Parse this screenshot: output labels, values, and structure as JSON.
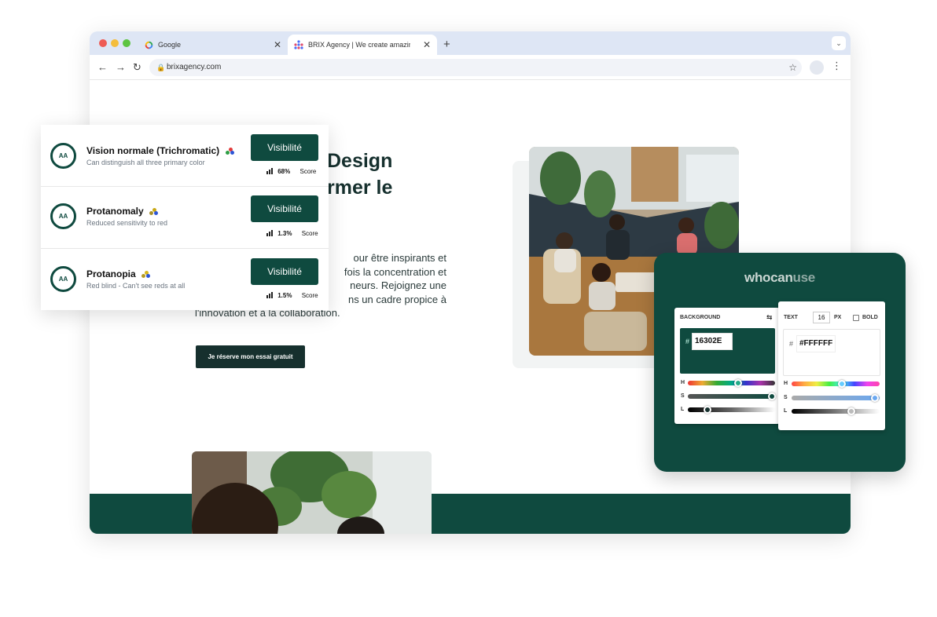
{
  "browser": {
    "tabs": [
      {
        "label": "Google",
        "close": "✕"
      },
      {
        "label": "BRIX Agency | We create amazing w",
        "close": "✕"
      }
    ],
    "new_tab": "+",
    "tab_menu": "⌄",
    "nav": {
      "back": "←",
      "forward": "→",
      "reload": "↻"
    },
    "address": "brixagency.com",
    "star": "☆",
    "menu": "⋮"
  },
  "page": {
    "hero_title_line1": "Design",
    "hero_title_line2": "rmer le",
    "hero_text_lines": [
      "our être inspirants et",
      "fois la concentration et",
      "neurs. Rejoignez une",
      "ns un cadre propice à",
      "l'innovation et à la collaboration."
    ],
    "cta_label": "Je réserve mon essai gratuit"
  },
  "vision": {
    "items": [
      {
        "badge": "AA",
        "name": "Vision normale (Trichromatic)",
        "description": "Can distinguish all three primary color",
        "button": "Visibilité",
        "percent": "68%",
        "score_label": "Score"
      },
      {
        "badge": "AA",
        "name": "Protanomaly",
        "description": "Reduced sensitivity to red",
        "button": "Visibilité",
        "percent": "1.3%",
        "score_label": "Score"
      },
      {
        "badge": "AA",
        "name": "Protanopia",
        "description": "Red blind - Can't see reds at all",
        "button": "Visibilité",
        "percent": "1.5%",
        "score_label": "Score"
      }
    ]
  },
  "whocanuse": {
    "logo_a": "whocan",
    "logo_b": "use",
    "background": {
      "label": "BACKGROUND",
      "hash": "#",
      "hex": "16302E",
      "h": "H",
      "s": "S",
      "l": "L",
      "swap_icon": "⇆"
    },
    "text": {
      "label": "TEXT",
      "size": "16",
      "unit": "PX",
      "bold_label": "BOLD",
      "hash": "#",
      "hex": "#FFFFFF",
      "h": "H",
      "s": "S",
      "l": "L"
    }
  },
  "colors": {
    "brand_dark": "#16302E",
    "brand_green": "#0F4A3F",
    "tab_bar": "#DEE6F5"
  }
}
